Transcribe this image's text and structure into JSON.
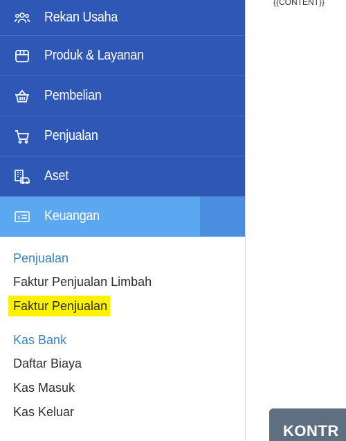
{
  "sidebar": {
    "nav_items": [
      {
        "label": "Rekan Usaha",
        "icon": "people-group-icon"
      },
      {
        "label": "Produk & Layanan",
        "icon": "box-icon"
      },
      {
        "label": "Pembelian",
        "icon": "basket-icon"
      },
      {
        "label": "Penjualan",
        "icon": "cart-icon"
      },
      {
        "label": "Aset",
        "icon": "building-car-icon"
      },
      {
        "label": "Keuangan",
        "icon": "money-card-icon"
      }
    ],
    "active_item": "Keuangan",
    "submenu": {
      "groups": [
        {
          "header": "Penjualan",
          "items": [
            "Faktur Penjualan Limbah",
            "Faktur Penjualan"
          ]
        },
        {
          "header": "Kas Bank",
          "items": [
            "Daftar Biaya",
            "Kas Masuk",
            "Kas Keluar"
          ]
        }
      ],
      "highlighted_item": "Faktur Penjualan"
    }
  },
  "main": {
    "content_placeholder": "{{CONTENT}}",
    "bottom_button": "KONTR"
  },
  "colors": {
    "nav_bg": "#2f57b5",
    "nav_active_bg": "#5ba7f0",
    "submenu_header": "#3a82c4",
    "highlight": "#fff200"
  }
}
